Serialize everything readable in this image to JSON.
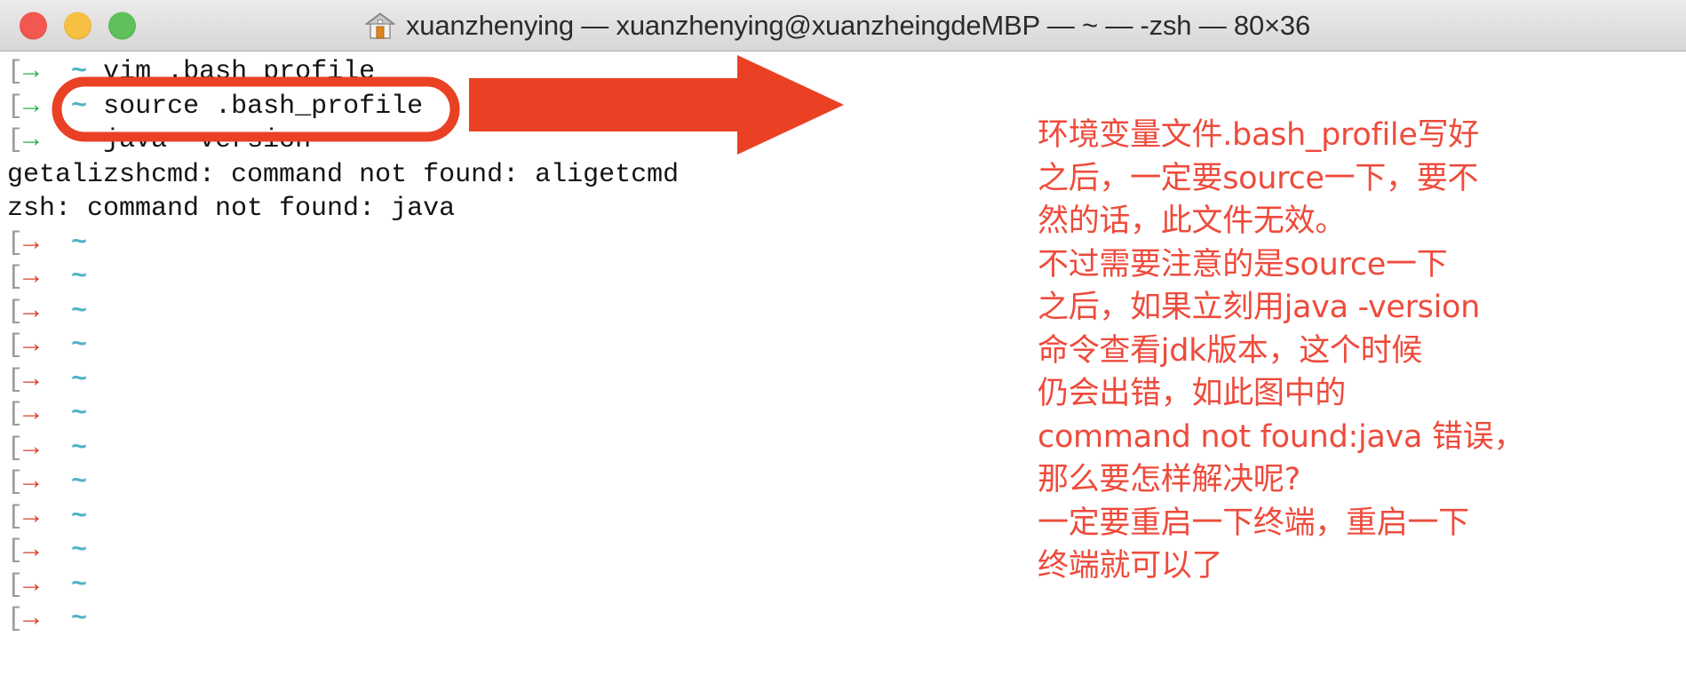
{
  "window": {
    "title": "xuanzhenying — xuanzhenying@xuanzheingdeMBP — ~ — -zsh — 80×36",
    "traffic_lights": {
      "close_label": "close",
      "minimize_label": "minimize",
      "zoom_label": "zoom"
    },
    "icon": "home-icon"
  },
  "colors": {
    "prompt_bracket": "#9b9b9b",
    "arrow_success": "#2bb24c",
    "arrow_error": "#d9412b",
    "tilde": "#4fb3c4",
    "annotation_red": "#ee4b3c",
    "highlight_stroke": "#ea4125",
    "terminal_text": "#141414",
    "titlebar_bg": "#e4e2e2"
  },
  "terminal": {
    "prompt_bracket_open": "[",
    "prompt_arrow": "→",
    "prompt_tilde": "~",
    "lines": [
      {
        "type": "prompt",
        "status": "ok",
        "command": "vim .bash_profile"
      },
      {
        "type": "prompt",
        "status": "ok",
        "command": "source .bash_profile"
      },
      {
        "type": "prompt",
        "status": "ok",
        "command": "java -version"
      },
      {
        "type": "output",
        "text": "getalizshcmd: command not found: aligetcmd"
      },
      {
        "type": "output",
        "text": "zsh: command not found: java"
      },
      {
        "type": "prompt",
        "status": "err",
        "command": ""
      },
      {
        "type": "prompt",
        "status": "err",
        "command": ""
      },
      {
        "type": "prompt",
        "status": "err",
        "command": ""
      },
      {
        "type": "prompt",
        "status": "err",
        "command": ""
      },
      {
        "type": "prompt",
        "status": "err",
        "command": ""
      },
      {
        "type": "prompt",
        "status": "err",
        "command": ""
      },
      {
        "type": "prompt",
        "status": "err",
        "command": ""
      },
      {
        "type": "prompt",
        "status": "err",
        "command": ""
      },
      {
        "type": "prompt",
        "status": "err",
        "command": ""
      },
      {
        "type": "prompt",
        "status": "err",
        "command": ""
      },
      {
        "type": "prompt",
        "status": "err",
        "command": ""
      },
      {
        "type": "prompt",
        "status": "err",
        "command": ""
      }
    ]
  },
  "annotations": {
    "highlight_target": "source .bash_profile",
    "arrow_label": "red-arrow-pointing-right",
    "note_text": "环境变量文件.bash_profile写好\n之后，一定要source一下，要不\n然的话，此文件无效。\n不过需要注意的是source一下\n之后，如果立刻用java -version\n命令查看jdk版本，这个时候\n仍会出错，如此图中的\ncommand not found:java 错误，\n那么要怎样解决呢?\n一定要重启一下终端，重启一下\n终端就可以了"
  }
}
